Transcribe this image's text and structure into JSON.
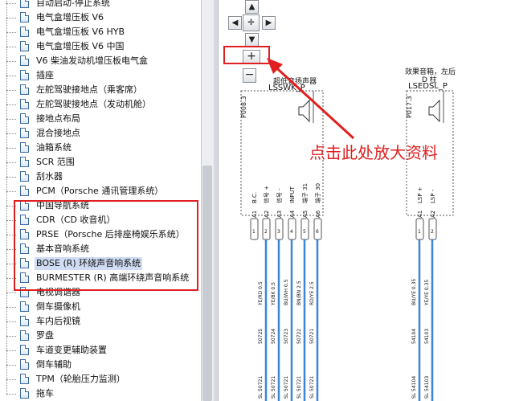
{
  "tree": {
    "items": [
      {
        "label": "自动启动-停止系统"
      },
      {
        "label": "电气盒增压板 V6"
      },
      {
        "label": "电气盒增压板 V6 HYB"
      },
      {
        "label": "电气盒增压板 V6 中国"
      },
      {
        "label": "V6 柴油发动机增压板电气盒"
      },
      {
        "label": "插座"
      },
      {
        "label": "左舵驾驶接地点（乘客席）"
      },
      {
        "label": "左舵驾驶接地点（发动机舱）"
      },
      {
        "label": "接地点布局"
      },
      {
        "label": "混合接地点"
      },
      {
        "label": "油箱系统"
      },
      {
        "label": "SCR 范围"
      },
      {
        "label": "刮水器"
      },
      {
        "label": "PCM（Porsche 通讯管理系统）"
      },
      {
        "label": "中国导航系统"
      },
      {
        "label": "CDR（CD 收音机）"
      },
      {
        "label": "PRSE（Porsche 后排座椅娱乐系统）"
      },
      {
        "label": "基本音响系统"
      },
      {
        "label": "BOSE (R) 环绕声音响系统"
      },
      {
        "label": "BURMESTER (R) 高端环绕声音响系统"
      },
      {
        "label": "电视调谐器"
      },
      {
        "label": "倒车摄像机"
      },
      {
        "label": "车内后视镜"
      },
      {
        "label": "罗盘"
      },
      {
        "label": "车道变更辅助装置"
      },
      {
        "label": "倒车辅助"
      },
      {
        "label": "TPM（轮胎压力监测）"
      },
      {
        "label": "拖车"
      }
    ],
    "selected_index": 18
  },
  "nav": {
    "up": "▲",
    "left": "◀",
    "center": "✛",
    "right": "▶",
    "down": "▼",
    "zoom_in": "+",
    "zoom_out": "−"
  },
  "diagram": {
    "left_component": {
      "title": "超低音扬声器",
      "code": "LSSWK_P",
      "ref": "P008.3",
      "pin_labels": [
        "B.C.",
        "信号 +",
        "信号 -",
        "INPUT",
        "端子 31",
        "端子 30"
      ],
      "pins": [
        "A1",
        "A2",
        "A3",
        "A4",
        "A5",
        "A6"
      ],
      "pin_nums": [
        "1",
        "2",
        "3",
        "4",
        "5",
        "6"
      ],
      "wire_colors": [
        "YE/RD 0.5",
        "YE/BK 0.5",
        "BU/WH 0.5",
        "BN/BN 2.5",
        "RD/YE 2.5"
      ],
      "wire_ids": [
        "50725",
        "50724",
        "50723",
        "50722",
        "50721"
      ],
      "bottom_ids": [
        "SL 50721",
        "SL 50721",
        "SL 50721",
        "SL 50721",
        "SL 50721"
      ]
    },
    "right_component": {
      "title1": "效果音箱，左后",
      "title2": "D 柱",
      "code": "LSEDSL_P",
      "ref": "P017.3",
      "pin_labels": [
        "LSP +",
        "LSP -"
      ],
      "pins": [
        "A1",
        "A2"
      ],
      "pin_nums": [
        "1",
        "2"
      ],
      "wire_colors": [
        "BU/YE 0.35",
        "YE/YE 0.35"
      ],
      "wire_ids": [
        "54104",
        "54103"
      ],
      "bottom_ids": [
        "SL 54104",
        "SL 54103"
      ]
    }
  },
  "annotation": {
    "text": "点击此处放大资料",
    "color": "#e02020"
  },
  "colors": {
    "wire": "#3a86d8",
    "highlight": "#e02020",
    "selected": "#cfdcf3"
  }
}
